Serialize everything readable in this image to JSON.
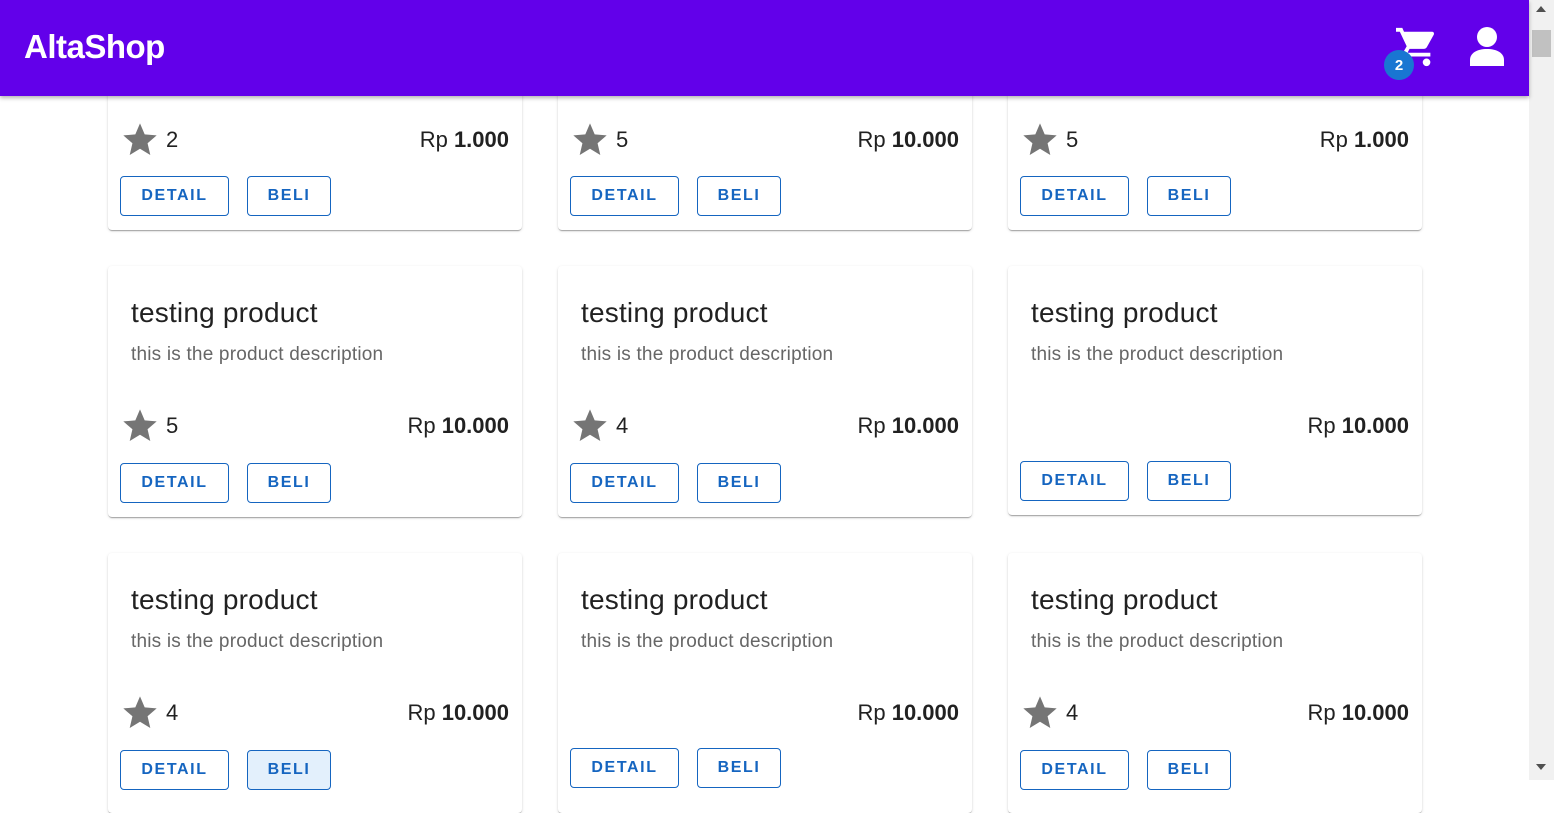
{
  "app": {
    "title": "AltaShop"
  },
  "cart": {
    "count": "2"
  },
  "buttons": {
    "detail": "DETAIL",
    "beli": "BELI"
  },
  "currency": "Rp",
  "cards": [
    {
      "title": "",
      "description": "",
      "rating": "2",
      "price": "1.000"
    },
    {
      "title": "",
      "description": "",
      "rating": "5",
      "price": "10.000"
    },
    {
      "title": "",
      "description": "",
      "rating": "5",
      "price": "1.000"
    },
    {
      "title": "testing product",
      "description": "this is the product description",
      "rating": "5",
      "price": "10.000"
    },
    {
      "title": "testing product",
      "description": "this is the product description",
      "rating": "4",
      "price": "10.000"
    },
    {
      "title": "testing product",
      "description": "this is the product description",
      "rating": "",
      "price": "10.000"
    },
    {
      "title": "testing product",
      "description": "this is the product description",
      "rating": "4",
      "price": "10.000"
    },
    {
      "title": "testing product",
      "description": "this is the product description",
      "rating": "",
      "price": "10.000"
    },
    {
      "title": "testing product",
      "description": "this is the product description",
      "rating": "4",
      "price": "10.000"
    }
  ],
  "icons": {
    "cart": "cart-icon",
    "user": "account-icon",
    "rating": "star-icon"
  },
  "colors": {
    "appbar": "#6200ea",
    "badge": "#1976d2",
    "button": "#1565c0",
    "star": "#757575"
  }
}
